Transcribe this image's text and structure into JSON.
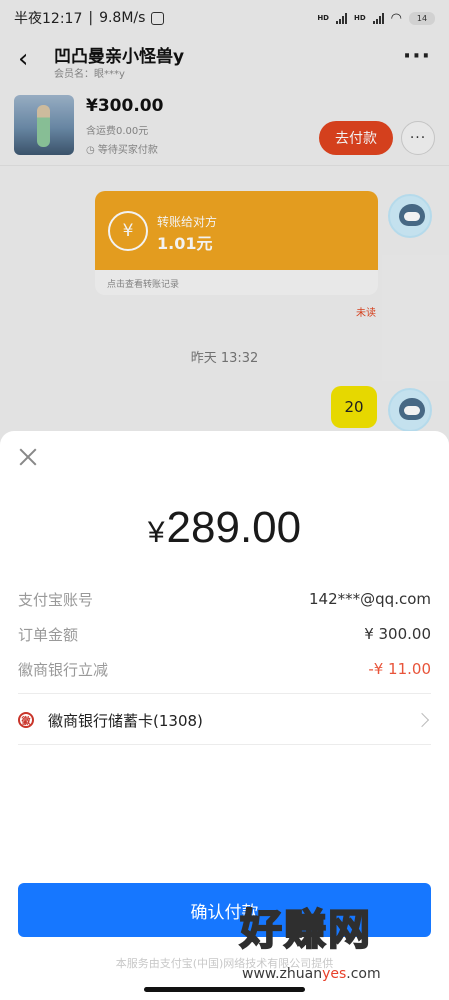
{
  "status_bar": {
    "time": "半夜12:17",
    "speed": "9.8M/s",
    "battery": "14"
  },
  "header": {
    "title": "凹凸曼亲小怪兽y",
    "member_name": "会员名：眼***y"
  },
  "order": {
    "price": "¥300.00",
    "freight": "含运费0.00元",
    "status": "等待买家付款",
    "pay_button": "去付款"
  },
  "chat": {
    "transfer_title": "转账给对方",
    "transfer_amount": "1.01元",
    "transfer_link": "点击查看转账记录",
    "unread": "未读",
    "timestamp": "昨天 13:32",
    "message": "20"
  },
  "payment": {
    "currency": "¥",
    "amount": "289.00",
    "rows": [
      {
        "label": "支付宝账号",
        "value": "142***@qq.com"
      },
      {
        "label": "订单金额",
        "value": "¥ 300.00"
      },
      {
        "label": "徽商银行立减",
        "value": "-¥ 11.00"
      }
    ],
    "bank_card": "徽商银行储蓄卡(1308)",
    "confirm_button": "确认付款",
    "footer": "本服务由支付宝(中国)网络技术有限公司提供"
  },
  "watermark": {
    "big": "好赚网",
    "small_pre": "www.zhuan",
    "small_hl": "yes",
    "small_post": ".com"
  },
  "colors": {
    "pay_button": "#e0441f",
    "confirm_button": "#1677ff",
    "discount": "#e8543a",
    "transfer_card": "#f0a521"
  }
}
